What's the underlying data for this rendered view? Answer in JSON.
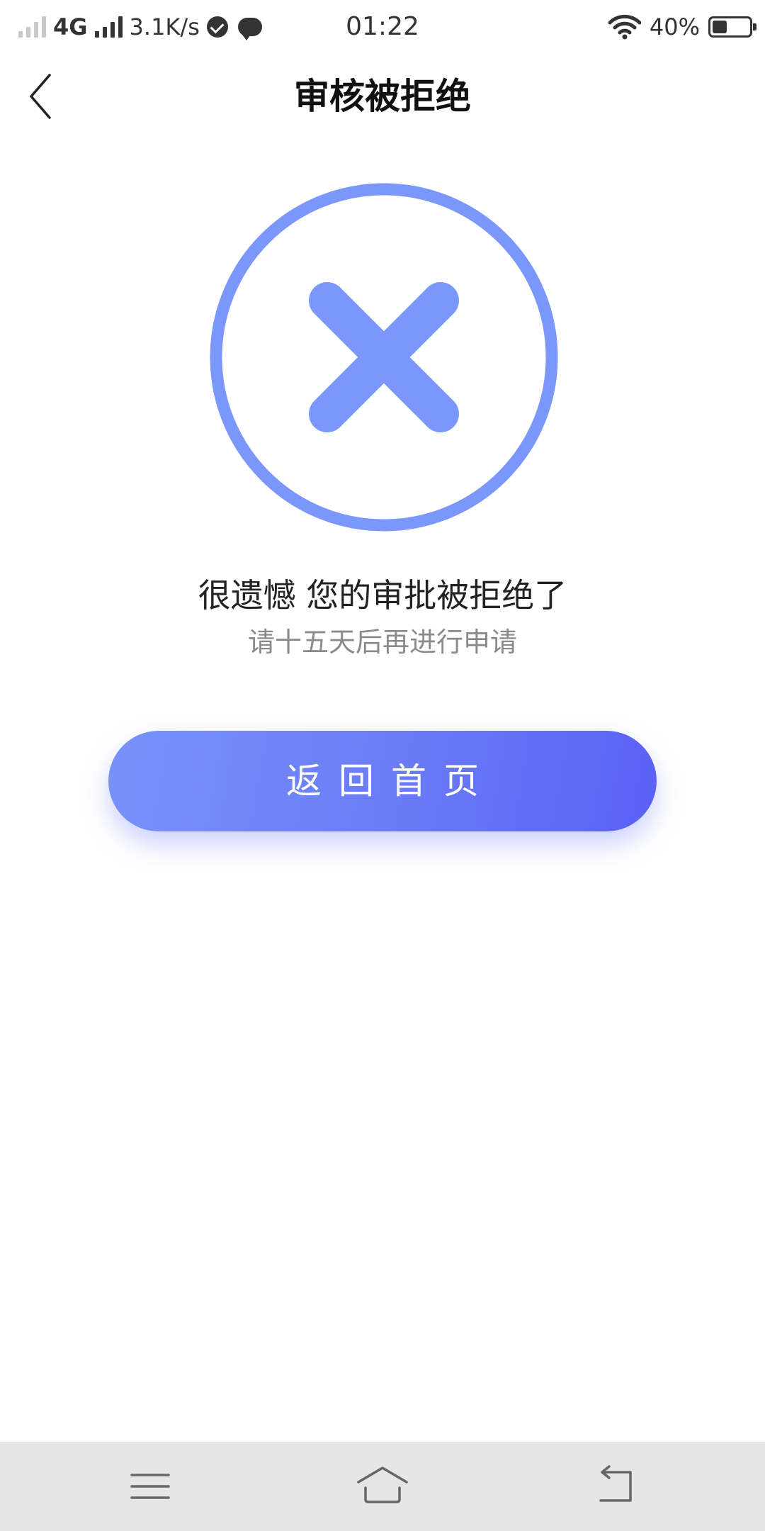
{
  "status_bar": {
    "network": "4G",
    "speed": "3.1K/s",
    "time": "01:22",
    "battery_percent": "40%",
    "battery_level": 0.4,
    "icons": [
      "signal-weak-icon",
      "signal-icon",
      "check-circle-icon",
      "chat-icon",
      "wifi-icon",
      "battery-icon"
    ]
  },
  "header": {
    "title": "审核被拒绝",
    "back_icon": "chevron-left-icon"
  },
  "result": {
    "icon": "close-circle-icon",
    "icon_color": "#7b97fb",
    "message": "很遗憾 您的审批被拒绝了",
    "hint": "请十五天后再进行申请"
  },
  "actions": {
    "home_button_label": "返回首页",
    "gradient_start": "#7892fb",
    "gradient_end": "#5b60f5"
  },
  "system_nav": {
    "icons": [
      "menu-icon",
      "home-icon",
      "back-icon"
    ]
  }
}
